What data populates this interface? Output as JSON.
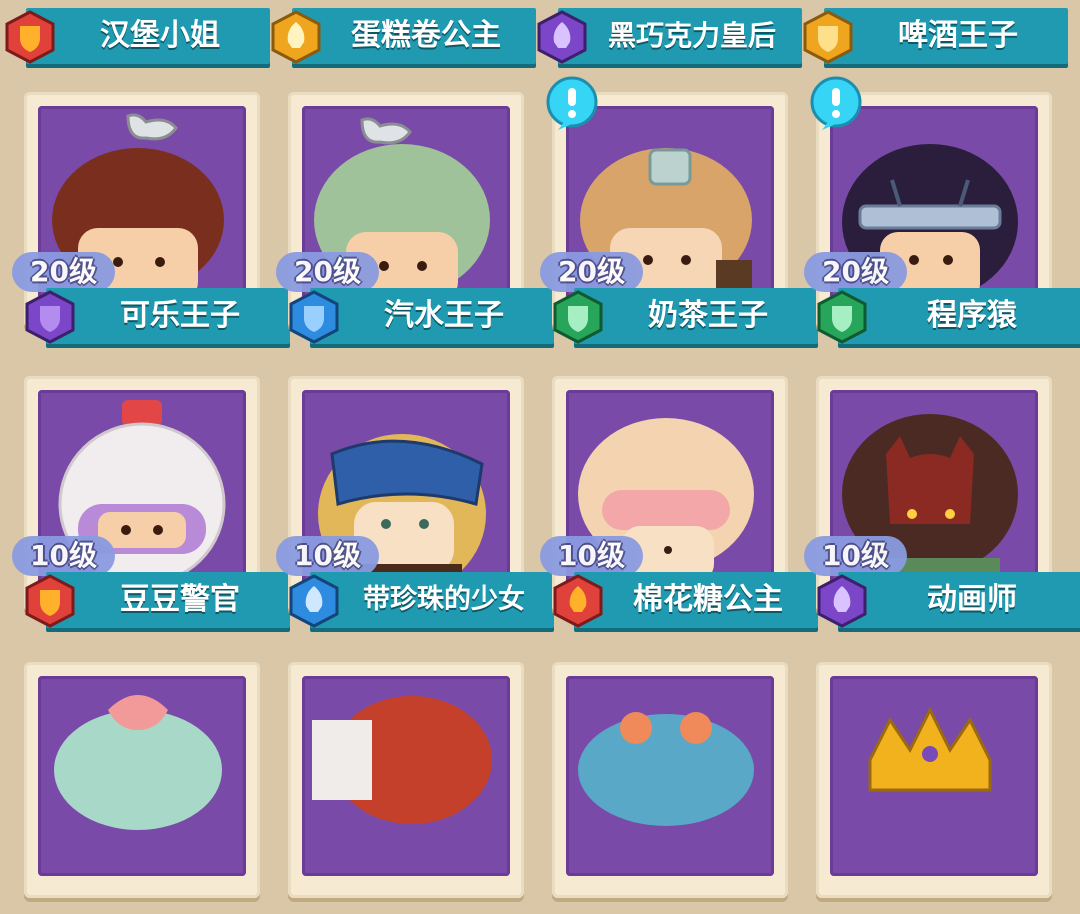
{
  "top_row": [
    {
      "name": "汉堡小姐",
      "badge": "shield-icon",
      "badge_color": "#e0413b"
    },
    {
      "name": "蛋糕卷公主",
      "badge": "rocket-icon",
      "badge_color": "#f0a51e"
    },
    {
      "name": "黑巧克力皇后",
      "badge": "rocket-icon",
      "badge_color": "#7b46c7"
    },
    {
      "name": "啤酒王子",
      "badge": "shield-icon",
      "badge_color": "#f0a51e"
    }
  ],
  "row2": [
    {
      "name": "可乐王子",
      "level": "20级",
      "badge": "shield-icon",
      "badge_color": "#7b46c7",
      "hair": "#7a2f1e",
      "alert": false
    },
    {
      "name": "汽水王子",
      "level": "20级",
      "badge": "shield-icon",
      "badge_color": "#2d8be0",
      "hair": "#9fc29a",
      "alert": false
    },
    {
      "name": "奶茶王子",
      "level": "20级",
      "badge": "shield-icon",
      "badge_color": "#27a55a",
      "hair": "#d8a46a",
      "alert": true
    },
    {
      "name": "程序猿",
      "level": "20级",
      "badge": "shield-icon",
      "badge_color": "#27a55a",
      "hair": "#2b1e3c",
      "alert": true
    }
  ],
  "row3": [
    {
      "name": "豆豆警官",
      "level": "10级",
      "badge": "shield-icon",
      "badge_color": "#e0413b",
      "hair": "#f1ecee"
    },
    {
      "name": "带珍珠的少女",
      "level": "10级",
      "badge": "rocket-icon",
      "badge_color": "#2d8be0",
      "hair": "#2f5fa8"
    },
    {
      "name": "棉花糖公主",
      "level": "10级",
      "badge": "rocket-icon",
      "badge_color": "#e0413b",
      "hair": "#f3d3b0"
    },
    {
      "name": "动画师",
      "level": "10级",
      "badge": "rocket-icon",
      "badge_color": "#7b46c7",
      "hair": "#6b2a22"
    }
  ]
}
